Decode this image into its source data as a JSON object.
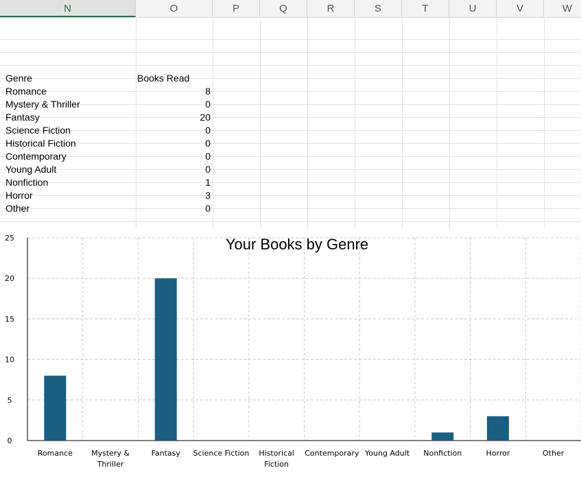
{
  "columns": [
    "N",
    "O",
    "P",
    "Q",
    "R",
    "S",
    "T",
    "U",
    "V",
    "W"
  ],
  "selected_column": "N",
  "table": {
    "header": {
      "genre": "Genre",
      "books_read": "Books Read"
    },
    "rows": [
      {
        "genre": "Romance",
        "count": "8"
      },
      {
        "genre": "Mystery & Thriller",
        "count": "0"
      },
      {
        "genre": "Fantasy",
        "count": "20"
      },
      {
        "genre": "Science Fiction",
        "count": "0"
      },
      {
        "genre": "Historical Fiction",
        "count": "0"
      },
      {
        "genre": "Contemporary",
        "count": "0"
      },
      {
        "genre": "Young Adult",
        "count": "0"
      },
      {
        "genre": "Nonfiction",
        "count": "1"
      },
      {
        "genre": "Horror",
        "count": "3"
      },
      {
        "genre": "Other",
        "count": "0"
      }
    ]
  },
  "chart_data": {
    "type": "bar",
    "title": "Your Books by Genre",
    "categories": [
      "Romance",
      "Mystery & Thriller",
      "Fantasy",
      "Science Fiction",
      "Historical Fiction",
      "Contemporary",
      "Young Adult",
      "Nonfiction",
      "Horror",
      "Other"
    ],
    "category_labels": [
      [
        "Romance"
      ],
      [
        "Mystery &",
        "Thriller"
      ],
      [
        "Fantasy"
      ],
      [
        "Science Fiction"
      ],
      [
        "Historical",
        "Fiction"
      ],
      [
        "Contemporary"
      ],
      [
        "Young Adult"
      ],
      [
        "Nonfiction"
      ],
      [
        "Horror"
      ],
      [
        "Other"
      ]
    ],
    "values": [
      8,
      0,
      20,
      0,
      0,
      0,
      0,
      1,
      3,
      0
    ],
    "ylim": [
      0,
      25
    ],
    "yticks": [
      "0",
      "5",
      "10",
      "15",
      "20",
      "25"
    ],
    "grid": true,
    "bar_color": "#1a5e82",
    "xlabel": "",
    "ylabel": ""
  }
}
